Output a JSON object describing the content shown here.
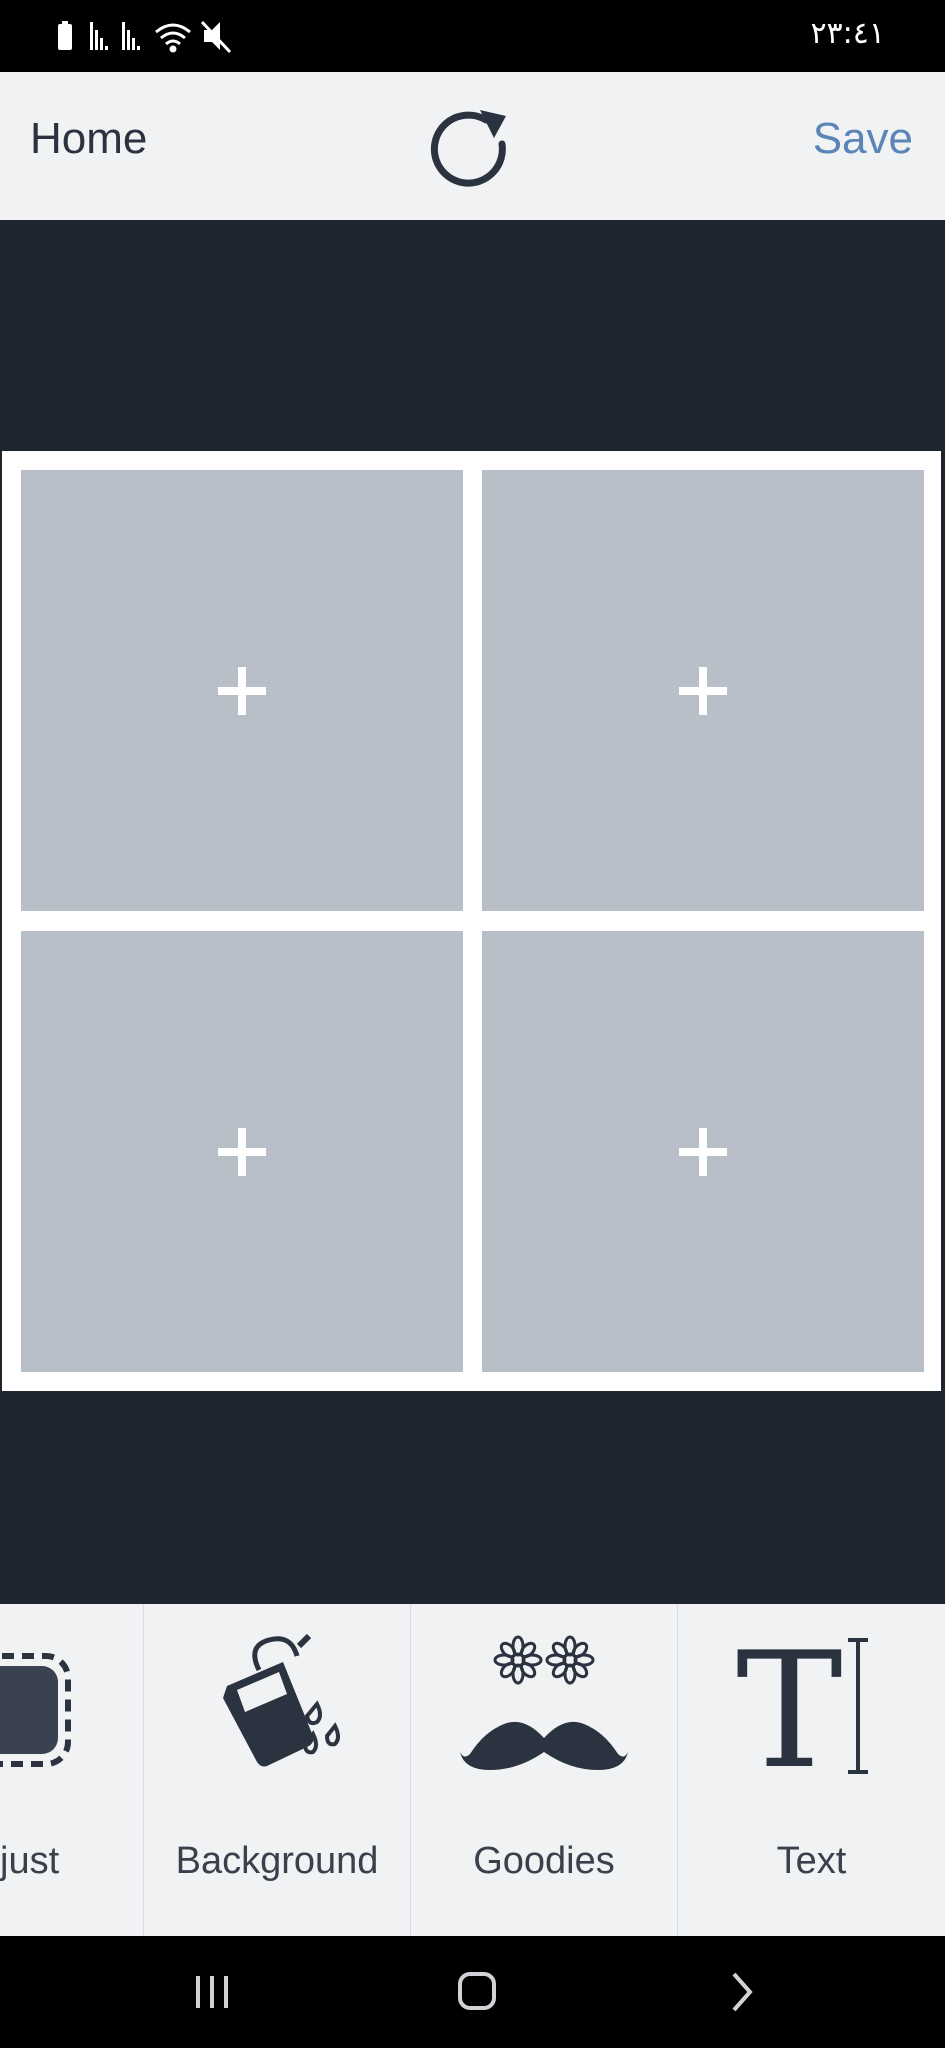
{
  "status_bar": {
    "time": "٢٣:٤١",
    "icons": [
      "battery-icon",
      "signal-icon",
      "signal-icon",
      "wifi-icon",
      "mute-icon"
    ]
  },
  "toolbar": {
    "home_label": "Home",
    "refresh_icon": "refresh-icon",
    "save_label": "Save"
  },
  "collage": {
    "cells": [
      {
        "icon": "plus-icon"
      },
      {
        "icon": "plus-icon"
      },
      {
        "icon": "plus-icon"
      },
      {
        "icon": "plus-icon"
      }
    ]
  },
  "tools": {
    "items": [
      {
        "label": "just",
        "icon": "adjust-frame-icon"
      },
      {
        "label": "Background",
        "icon": "paint-bucket-icon"
      },
      {
        "label": "Goodies",
        "icon": "mustache-icon"
      },
      {
        "label": "Text",
        "icon": "text-cursor-icon"
      }
    ]
  },
  "navbar": {
    "icons": [
      "recent-apps-icon",
      "home-icon",
      "back-icon"
    ]
  },
  "colors": {
    "canvas_bg": "#1f252e",
    "toolbar_bg": "#f0f2f4",
    "cell_bg": "#b9bfc9",
    "accent": "#5b85b6",
    "text": "#2c3340"
  }
}
